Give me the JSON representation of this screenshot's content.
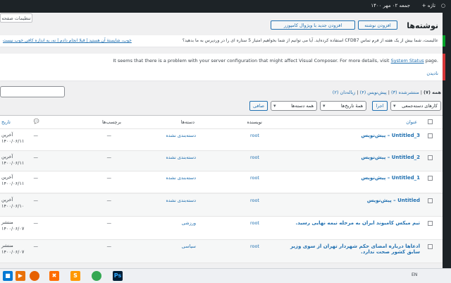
{
  "admin_bar": {
    "date": "جمعه ۰۲ مهر ۱۴۰۰",
    "new": "+ تازه"
  },
  "header": {
    "title": "نوشته‌ها",
    "add_new": "افزودن نوشته",
    "add_new_vc": "افزودن جدید با ویژوال کامپوزر",
    "screen_options": "تنظیمات صفحه"
  },
  "notices": {
    "cf7": "عالیست، شما بیش از یک هفته از فرم تماس CFDB7 استفاده کرده‌اید. آیا می توانیم از شما بخواهیم امتیاز 5 ستاره ای را در وردپرس به ما بدهید؟",
    "cf7_links": "خوب، شایستهٔ آن هستید | قبلا انجام دادم | نه، به اندازه کافی خوب نیست",
    "vc_text": "It seems that there is a problem with your server configuration that might affect Visual Composer. For more details, visit",
    "vc_link": "System Status",
    "vc_after": "page.",
    "vc_dismiss": "نادیدن"
  },
  "filters": {
    "all": "همه (۷)",
    "published": "منتشرشده (۳)",
    "drafts": "پیش‌نویس (۴)",
    "trash": "زباله‌دان (۲)",
    "bulk": "کارهای دسته‌جمعی",
    "apply": "اجرا",
    "dates": "همهٔ تاریخ‌ها",
    "cats": "همه دسته‌ها",
    "filter": "صافی"
  },
  "columns": {
    "title": "عنوان",
    "author": "نویسنده",
    "categories": "دسته‌ها",
    "tags": "برچسب‌ها",
    "comments": "💬",
    "date": "تاریخ"
  },
  "rows": [
    {
      "title": "Untitled_3 – پیش‌نویس",
      "author": "root",
      "cat": "دسته‌بندی نشده",
      "tags": "—",
      "comments": "—",
      "date1": "آخرین",
      "date2": "۱۴۰۰/۰۶/۱۱"
    },
    {
      "title": "Untitled_2 – پیش‌نویس",
      "author": "root",
      "cat": "دسته‌بندی نشده",
      "tags": "—",
      "comments": "—",
      "date1": "آخرین",
      "date2": "۱۴۰۰/۰۶/۱۱"
    },
    {
      "title": "Untitled_1 – پیش‌نویس",
      "author": "root",
      "cat": "دسته‌بندی نشده",
      "tags": "—",
      "comments": "—",
      "date1": "آخرین",
      "date2": "۱۴۰۰/۰۶/۱۱"
    },
    {
      "title": "Untitled – پیش‌نویس",
      "author": "root",
      "cat": "دسته‌بندی نشده",
      "tags": "—",
      "comments": "—",
      "date1": "آخرین",
      "date2": "۱۴۰۰/۰۶/۱۰"
    },
    {
      "title": "تیم میکس کامیوند ایران به مرحله نیمه نهایی رسید.",
      "author": "root",
      "cat": "ورزشی",
      "tags": "—",
      "comments": "—",
      "date1": "منتشر",
      "date2": "۱۴۰۰/۰۶/۰۷"
    },
    {
      "title": "ادعاها درباره امضای حکم شهردار تهران از سوی وزیر سابق کشور صحت ندارد.",
      "author": "root",
      "cat": "سیاسی",
      "tags": "—",
      "comments": "—",
      "date1": "منتشر",
      "date2": "۱۴۰۰/۰۶/۰۷"
    }
  ],
  "taskbar": {
    "lang": "EN"
  }
}
